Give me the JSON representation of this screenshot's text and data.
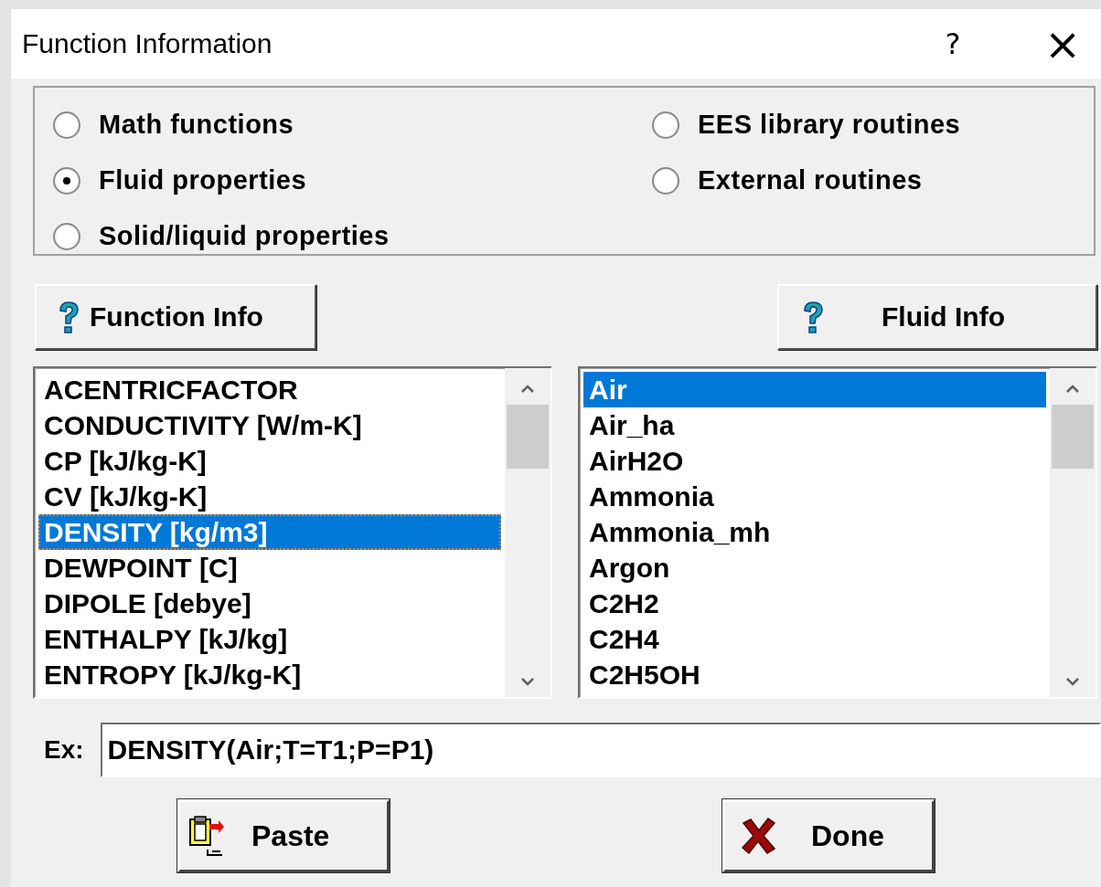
{
  "window": {
    "title": "Function Information",
    "help": "?",
    "close": "×"
  },
  "categories": [
    {
      "label": "Math functions",
      "selected": false
    },
    {
      "label": "EES library routines",
      "selected": false
    },
    {
      "label": "Fluid properties",
      "selected": true
    },
    {
      "label": "External routines",
      "selected": false
    },
    {
      "label": "Solid/liquid properties",
      "selected": false
    }
  ],
  "info_buttons": [
    {
      "label": "Function Info"
    },
    {
      "label": "Fluid Info"
    }
  ],
  "lists": [
    {
      "focused": true,
      "items": [
        {
          "label": "ACENTRICFACTOR",
          "selected": false
        },
        {
          "label": "CONDUCTIVITY [W/m-K]",
          "selected": false
        },
        {
          "label": "CP [kJ/kg-K]",
          "selected": false
        },
        {
          "label": "CV [kJ/kg-K]",
          "selected": false
        },
        {
          "label": "DENSITY [kg/m3]",
          "selected": true
        },
        {
          "label": "DEWPOINT [C]",
          "selected": false
        },
        {
          "label": "DIPOLE [debye]",
          "selected": false
        },
        {
          "label": "ENTHALPY [kJ/kg]",
          "selected": false
        },
        {
          "label": "ENTROPY [kJ/kg-K]",
          "selected": false
        }
      ]
    },
    {
      "focused": false,
      "items": [
        {
          "label": "Air",
          "selected": true
        },
        {
          "label": "Air_ha",
          "selected": false
        },
        {
          "label": "AirH2O",
          "selected": false
        },
        {
          "label": "Ammonia",
          "selected": false
        },
        {
          "label": "Ammonia_mh",
          "selected": false
        },
        {
          "label": "Argon",
          "selected": false
        },
        {
          "label": "C2H2",
          "selected": false
        },
        {
          "label": "C2H4",
          "selected": false
        },
        {
          "label": "C2H5OH",
          "selected": false
        }
      ]
    }
  ],
  "example": {
    "label": "Ex:",
    "value": "DENSITY(Air;T=T1;P=P1)"
  },
  "buttons": [
    {
      "kind": "paste",
      "label": "Paste"
    },
    {
      "kind": "done",
      "label": "Done"
    }
  ]
}
